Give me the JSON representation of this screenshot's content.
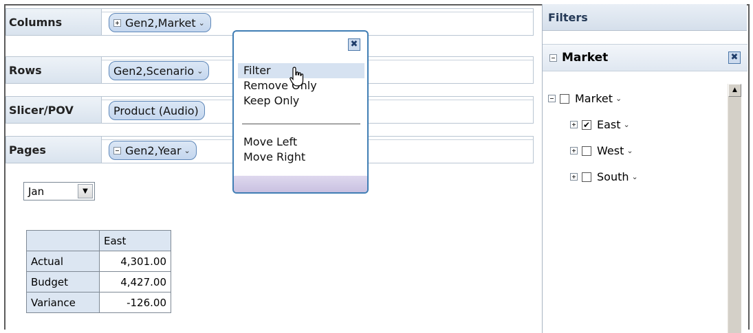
{
  "axes": {
    "columns": {
      "label": "Columns",
      "pill": "Gen2,Market"
    },
    "rows": {
      "label": "Rows",
      "pill": "Gen2,Scenario"
    },
    "slicer": {
      "label": "Slicer/POV",
      "pill": "Product (Audio)"
    },
    "pages": {
      "label": "Pages",
      "pill": "Gen2,Year"
    }
  },
  "icons": {
    "expand": "plus-box-icon",
    "collapse": "minus-box-icon",
    "dropdown": "chevron-down-icon",
    "close": "close-x-icon",
    "cursor": "hand-pointer-icon",
    "scroll_up": "scroll-up-arrow-icon"
  },
  "chevron": "⌄",
  "popup_menu": {
    "close_glyph": "✖",
    "items": [
      "Filter",
      "Remove Only",
      "Keep Only",
      "Move Left",
      "Move Right"
    ]
  },
  "page_select": {
    "value": "Jan",
    "arrow": "▼"
  },
  "grid": {
    "column_header": "East",
    "rows": [
      {
        "label": "Actual",
        "value": "4,301.00"
      },
      {
        "label": "Budget",
        "value": "4,427.00"
      },
      {
        "label": "Variance",
        "value": "-126.00"
      }
    ]
  },
  "filters": {
    "title": "Filters",
    "section": "Market",
    "close_glyph": "✖",
    "tree": [
      {
        "label": "Market",
        "checked": false,
        "check": ""
      },
      {
        "label": "East",
        "checked": true,
        "check": "✔"
      },
      {
        "label": "West",
        "checked": false,
        "check": ""
      },
      {
        "label": "South",
        "checked": false,
        "check": ""
      }
    ],
    "scroll_arrow": "▲"
  },
  "colors": {
    "pill_border": "#5d86b8",
    "pill_fill": "#c4d6ee",
    "popup_border": "#3f7db4",
    "menu_highlight": "#d6e2f1"
  }
}
